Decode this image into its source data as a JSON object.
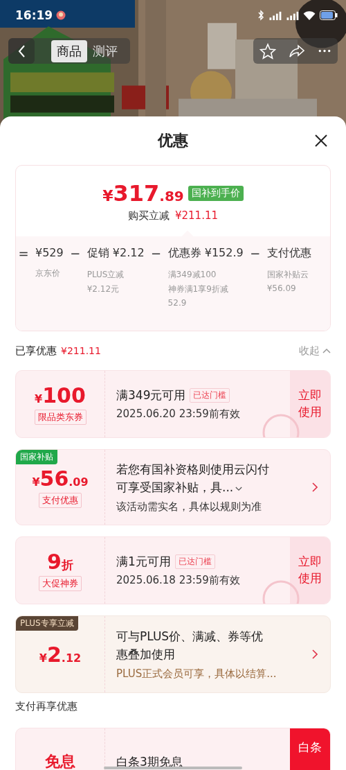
{
  "status_bar": {
    "time": "16:19"
  },
  "nav": {
    "tabs": [
      {
        "label": "商品",
        "selected": true
      },
      {
        "label": "测评",
        "selected": false
      }
    ]
  },
  "sheet": {
    "title": "优惠"
  },
  "summary": {
    "currency": "¥",
    "price": "317",
    "price_decimal": ".89",
    "price_tag": "国补到手价",
    "saving_label": "购买立减",
    "saving": "¥211.11",
    "breakdown": [
      {
        "op": "=",
        "amount": "¥529",
        "notes": [
          "京东价"
        ]
      },
      {
        "op": "−",
        "label": "促销",
        "amount": "¥2.12",
        "notes": [
          "PLUS立减",
          "¥2.12元"
        ]
      },
      {
        "op": "−",
        "label": "优惠券",
        "amount": "¥152.9",
        "notes": [
          "满349减100",
          "神券满1享9折减",
          "52.9"
        ]
      },
      {
        "op": "−",
        "label": "支付优惠",
        "notes": [
          "国家补贴云",
          "¥56.09"
        ]
      }
    ]
  },
  "enjoyed": {
    "label": "已享优惠",
    "amount": "¥211.11",
    "toggle": "收起"
  },
  "offers": [
    {
      "kind": "coupon",
      "currency": "¥",
      "amount": "100",
      "tag": "限品类东券",
      "title": "满349元可用",
      "badge": "已达门槛",
      "subtitle": "2025.06.20 23:59前有效",
      "action": {
        "text": "立即使用",
        "primary": false
      }
    },
    {
      "kind": "payment",
      "ribbon": {
        "text": "国家补贴",
        "color": "#20a84a"
      },
      "currency": "¥",
      "amount": "56",
      "decimal": ".09",
      "tag": "支付优惠",
      "title": "若您有国补资格则使用云闪付可享受国家补贴，具...",
      "expandable": true,
      "subtitle": "该活动需实名，具体以规则为准"
    },
    {
      "kind": "coupon",
      "amount": "9",
      "unit": "折",
      "tag": "大促神券",
      "title": "满1元可用",
      "badge": "已达门槛",
      "subtitle": "2025.06.18 23:59前有效",
      "action": {
        "text": "立即使用",
        "primary": false
      }
    },
    {
      "kind": "plus",
      "ribbon": {
        "text": "PLUS专享立减",
        "color": "#5a4535"
      },
      "currency": "¥",
      "amount": "2",
      "decimal": ".12",
      "title": "可与PLUS价、满减、券等优惠叠加使用",
      "subtitle": "PLUS正式会员可享，具体以结算..."
    }
  ],
  "pay_section": {
    "title": "支付再享优惠"
  },
  "pay_offers": [
    {
      "kind": "coupon",
      "amount": "免息",
      "title": "白条3期免息",
      "action": {
        "text": "白条",
        "primary": true
      }
    }
  ]
}
